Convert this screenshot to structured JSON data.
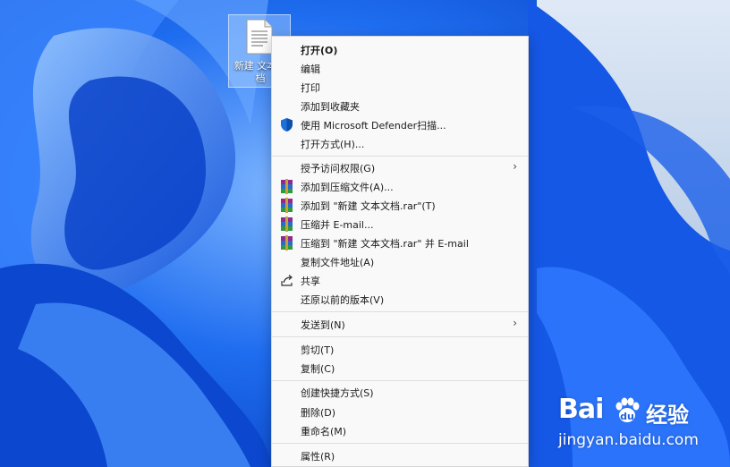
{
  "desktop": {
    "file_icon_label": "新建 文本文档",
    "file_icon_name": "text-document-icon"
  },
  "context_menu": {
    "items": [
      {
        "label": "打开(O)",
        "bold": true
      },
      {
        "label": "编辑"
      },
      {
        "label": "打印"
      },
      {
        "label": "添加到收藏夹"
      },
      {
        "label": "使用 Microsoft Defender扫描...",
        "icon": "defender-shield-icon"
      },
      {
        "label": "打开方式(H)..."
      },
      {
        "label": "授予访问权限(G)",
        "submenu": true
      },
      {
        "label": "添加到压缩文件(A)...",
        "icon": "winrar-icon"
      },
      {
        "label": "添加到 \"新建 文本文档.rar\"(T)",
        "icon": "winrar-icon"
      },
      {
        "label": "压缩并 E-mail...",
        "icon": "winrar-icon"
      },
      {
        "label": "压缩到 \"新建 文本文档.rar\" 并 E-mail",
        "icon": "winrar-icon"
      },
      {
        "label": "复制文件地址(A)"
      },
      {
        "label": "共享",
        "icon": "share-icon"
      },
      {
        "label": "还原以前的版本(V)"
      },
      {
        "label": "发送到(N)",
        "submenu": true
      },
      {
        "label": "剪切(T)"
      },
      {
        "label": "复制(C)"
      },
      {
        "label": "创建快捷方式(S)"
      },
      {
        "label": "删除(D)"
      },
      {
        "label": "重命名(M)"
      },
      {
        "label": "属性(R)"
      }
    ],
    "submenu_arrow": "›"
  },
  "watermark": {
    "brand": "Bai",
    "brand_suffix": "经验",
    "url": "jingyan.baidu.com"
  },
  "colors": {
    "wallpaper_blue": "#0a4fd8",
    "menu_bg": "#f9f9f9",
    "defender_blue": "#1f6fd8"
  }
}
